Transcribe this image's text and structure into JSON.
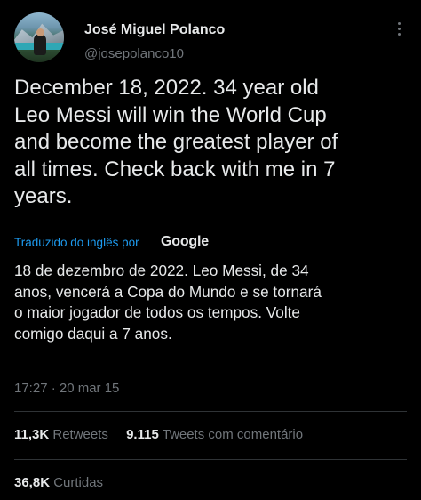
{
  "author": {
    "display_name": "José Miguel Polanco",
    "handle": "@josepolanco10"
  },
  "tweet": {
    "text": "December 18, 2022. 34 year old\nLeo Messi will win the World Cup\nand become the greatest player of\nall times. Check back with me in 7\nyears.",
    "translated_label": "Traduzido do inglês por",
    "translator": "Google",
    "translation": "18 de dezembro de 2022. Leo Messi, de 34\nanos, vencerá a Copa do Mundo e se tornará\no maior jogador de todos os tempos. Volte\ncomigo daqui a 7 anos.",
    "timestamp": "17:27 · 20 mar 15"
  },
  "stats": {
    "retweets_count": "11,3K",
    "retweets_label": "Retweets",
    "quotes_count": "9.115",
    "quotes_label": "Tweets com comentário",
    "views_count": "36,8K",
    "views_label": "Curtidas"
  },
  "colors": {
    "background": "#000000",
    "text": "#e7e9ea",
    "secondary": "#71767b",
    "link": "#1d9bf0",
    "divider": "#2f3336"
  }
}
